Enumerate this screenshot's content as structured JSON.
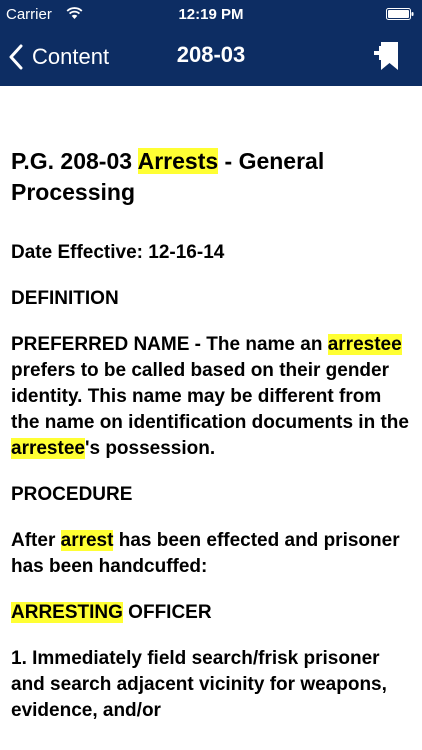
{
  "status": {
    "carrier": "Carrier",
    "time": "12:19 PM"
  },
  "nav": {
    "back_label": "Content",
    "title": "208-03"
  },
  "document": {
    "title": {
      "pre": "P.G. 208-03 ",
      "hl": "Arrests",
      "post": " - General Processing"
    },
    "date_effective": "Date Effective: 12-16-14",
    "definition_heading": "DEFINITION",
    "definition": {
      "pre": "PREFERRED NAME - The name an ",
      "hl1": "arrestee",
      "mid": " prefers to be called based on their gender identity. This name may be different from the name on identification documents in the ",
      "hl2": "arrestee",
      "post": "'s possession."
    },
    "procedure_heading": "PROCEDURE",
    "procedure_intro": {
      "pre": "After ",
      "hl": "arrest",
      "post": " has been effected and prisoner has been handcuffed:"
    },
    "officer_heading": {
      "hl": "ARRESTING",
      "post": " OFFICER"
    },
    "step1": "1. Immediately field search/frisk prisoner and search adjacent vicinity for weapons, evidence, and/or"
  },
  "colors": {
    "nav_background": "#0d2d63",
    "highlight": "#ffff33"
  }
}
